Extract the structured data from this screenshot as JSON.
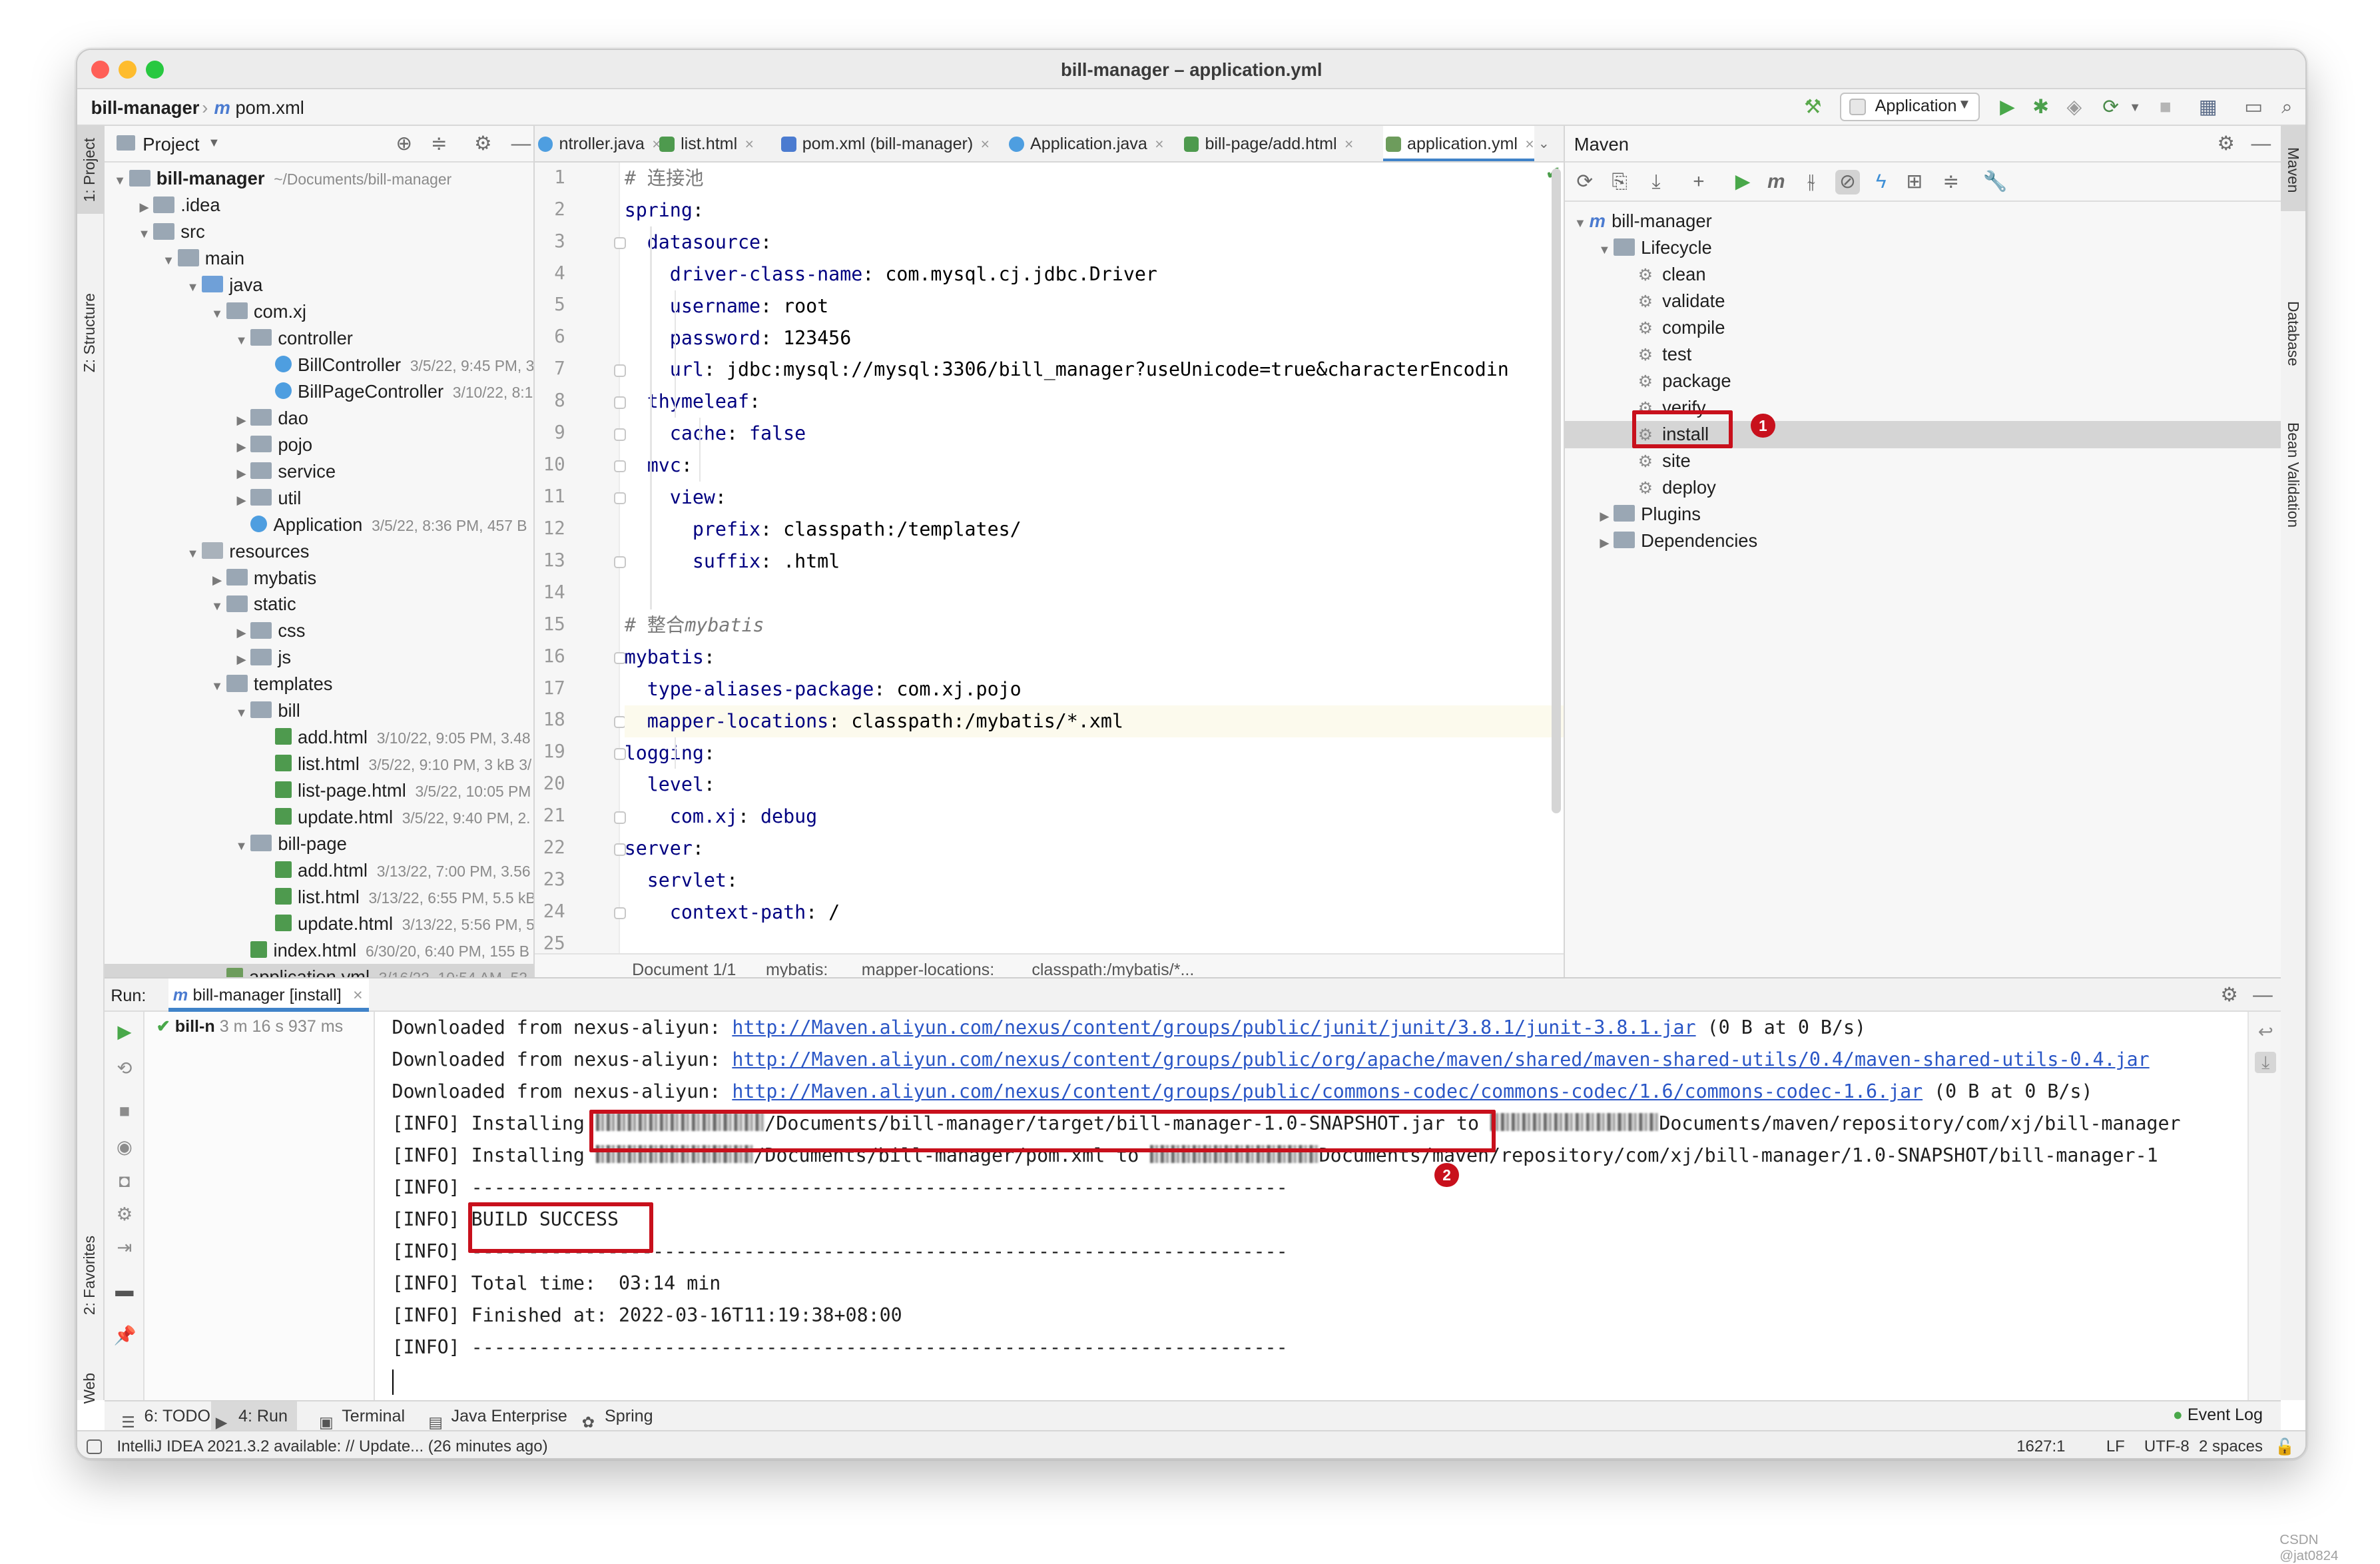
{
  "window": {
    "title": "bill-manager – application.yml"
  },
  "navbar": {
    "project": "bill-manager",
    "file": "pom.xml",
    "run_config": "Application"
  },
  "side_tabs": {
    "project": "1: Project",
    "structure": "Z: Structure",
    "favorites": "2: Favorites",
    "web": "Web",
    "maven": "Maven",
    "database": "Database",
    "bean_validation": "Bean Validation"
  },
  "project_panel": {
    "title": "Project",
    "tree": [
      {
        "level": 0,
        "arrow": "down",
        "icon": "folder",
        "label": "bill-manager",
        "bold": true,
        "meta": "~/Documents/bill-manager"
      },
      {
        "level": 1,
        "arrow": "right",
        "icon": "folder",
        "label": ".idea",
        "meta": ""
      },
      {
        "level": 1,
        "arrow": "down",
        "icon": "folder",
        "label": "src",
        "meta": ""
      },
      {
        "level": 2,
        "arrow": "down",
        "icon": "folder",
        "label": "main",
        "meta": ""
      },
      {
        "level": 3,
        "arrow": "down",
        "icon": "src",
        "label": "java",
        "meta": ""
      },
      {
        "level": 4,
        "arrow": "down",
        "icon": "folder",
        "label": "com.xj",
        "meta": ""
      },
      {
        "level": 5,
        "arrow": "down",
        "icon": "folder",
        "label": "controller",
        "meta": ""
      },
      {
        "level": 6,
        "arrow": "",
        "icon": "class",
        "label": "BillController",
        "meta": "3/5/22, 9:45 PM, 3"
      },
      {
        "level": 6,
        "arrow": "",
        "icon": "class",
        "label": "BillPageController",
        "meta": "3/10/22, 8:1"
      },
      {
        "level": 5,
        "arrow": "right",
        "icon": "folder",
        "label": "dao",
        "meta": ""
      },
      {
        "level": 5,
        "arrow": "right",
        "icon": "folder",
        "label": "pojo",
        "meta": ""
      },
      {
        "level": 5,
        "arrow": "right",
        "icon": "folder",
        "label": "service",
        "meta": ""
      },
      {
        "level": 5,
        "arrow": "right",
        "icon": "folder",
        "label": "util",
        "meta": ""
      },
      {
        "level": 5,
        "arrow": "",
        "icon": "class",
        "label": "Application",
        "meta": "3/5/22, 8:36 PM, 457 B"
      },
      {
        "level": 3,
        "arrow": "down",
        "icon": "res",
        "label": "resources",
        "meta": ""
      },
      {
        "level": 4,
        "arrow": "right",
        "icon": "folder",
        "label": "mybatis",
        "meta": ""
      },
      {
        "level": 4,
        "arrow": "down",
        "icon": "folder",
        "label": "static",
        "meta": ""
      },
      {
        "level": 5,
        "arrow": "right",
        "icon": "folder",
        "label": "css",
        "meta": ""
      },
      {
        "level": 5,
        "arrow": "right",
        "icon": "folder",
        "label": "js",
        "meta": ""
      },
      {
        "level": 4,
        "arrow": "down",
        "icon": "folder",
        "label": "templates",
        "meta": ""
      },
      {
        "level": 5,
        "arrow": "down",
        "icon": "folder",
        "label": "bill",
        "meta": ""
      },
      {
        "level": 6,
        "arrow": "",
        "icon": "html",
        "label": "add.html",
        "meta": "3/10/22, 9:05 PM, 3.48"
      },
      {
        "level": 6,
        "arrow": "",
        "icon": "html",
        "label": "list.html",
        "meta": "3/5/22, 9:10 PM, 3 kB 3/"
      },
      {
        "level": 6,
        "arrow": "",
        "icon": "html",
        "label": "list-page.html",
        "meta": "3/5/22, 10:05 PM"
      },
      {
        "level": 6,
        "arrow": "",
        "icon": "html",
        "label": "update.html",
        "meta": "3/5/22, 9:40 PM, 2."
      },
      {
        "level": 5,
        "arrow": "down",
        "icon": "folder",
        "label": "bill-page",
        "meta": ""
      },
      {
        "level": 6,
        "arrow": "",
        "icon": "html",
        "label": "add.html",
        "meta": "3/13/22, 7:00 PM, 3.56"
      },
      {
        "level": 6,
        "arrow": "",
        "icon": "html",
        "label": "list.html",
        "meta": "3/13/22, 6:55 PM, 5.5 kB"
      },
      {
        "level": 6,
        "arrow": "",
        "icon": "html",
        "label": "update.html",
        "meta": "3/13/22, 5:56 PM, 5"
      },
      {
        "level": 5,
        "arrow": "",
        "icon": "html",
        "label": "index.html",
        "meta": "6/30/20, 6:40 PM, 155 B"
      },
      {
        "level": 4,
        "arrow": "",
        "icon": "yml",
        "label": "application.yml",
        "meta": "3/16/22, 10:54 AM, 52"
      }
    ]
  },
  "editor": {
    "tabs": [
      {
        "label": "ntroller.java",
        "icon": "class",
        "active": false
      },
      {
        "label": "list.html",
        "icon": "html",
        "active": false
      },
      {
        "label": "pom.xml (bill-manager)",
        "icon": "maven",
        "active": false
      },
      {
        "label": "Application.java",
        "icon": "class",
        "active": false
      },
      {
        "label": "bill-page/add.html",
        "icon": "html",
        "active": false
      },
      {
        "label": "application.yml",
        "icon": "yml",
        "active": true
      }
    ],
    "lines": [
      {
        "n": "1",
        "segs": [
          [
            "cm",
            "# 连接池"
          ]
        ]
      },
      {
        "n": "2",
        "segs": [
          [
            "k",
            "spring"
          ],
          [
            "v",
            ":"
          ]
        ]
      },
      {
        "n": "3",
        "segs": [
          [
            "v",
            "  "
          ],
          [
            "k",
            "datasource"
          ],
          [
            "v",
            ":"
          ]
        ]
      },
      {
        "n": "4",
        "segs": [
          [
            "v",
            "    "
          ],
          [
            "k",
            "driver-class-name"
          ],
          [
            "v",
            ": com.mysql.cj.jdbc.Driver"
          ]
        ]
      },
      {
        "n": "5",
        "segs": [
          [
            "v",
            "    "
          ],
          [
            "k",
            "username"
          ],
          [
            "v",
            ": root"
          ]
        ]
      },
      {
        "n": "6",
        "segs": [
          [
            "v",
            "    "
          ],
          [
            "k",
            "password"
          ],
          [
            "v",
            ": 123456"
          ]
        ]
      },
      {
        "n": "7",
        "segs": [
          [
            "v",
            "    "
          ],
          [
            "k",
            "url"
          ],
          [
            "v",
            ": jdbc:mysql://mysql:3306/bill_manager?useUnicode=true&characterEncodin"
          ]
        ]
      },
      {
        "n": "8",
        "segs": [
          [
            "v",
            "  "
          ],
          [
            "k",
            "thymeleaf"
          ],
          [
            "v",
            ":"
          ]
        ]
      },
      {
        "n": "9",
        "segs": [
          [
            "v",
            "    "
          ],
          [
            "k",
            "cache"
          ],
          [
            "v",
            ": "
          ],
          [
            "b",
            "false"
          ]
        ]
      },
      {
        "n": "10",
        "segs": [
          [
            "v",
            "  "
          ],
          [
            "k",
            "mvc"
          ],
          [
            "v",
            ":"
          ]
        ]
      },
      {
        "n": "11",
        "segs": [
          [
            "v",
            "    "
          ],
          [
            "k",
            "view"
          ],
          [
            "v",
            ":"
          ]
        ]
      },
      {
        "n": "12",
        "segs": [
          [
            "v",
            "      "
          ],
          [
            "k",
            "prefix"
          ],
          [
            "v",
            ": classpath:/templates/"
          ]
        ]
      },
      {
        "n": "13",
        "segs": [
          [
            "v",
            "      "
          ],
          [
            "k",
            "suffix"
          ],
          [
            "v",
            ": .html"
          ]
        ]
      },
      {
        "n": "14",
        "segs": []
      },
      {
        "n": "15",
        "segs": [
          [
            "cm",
            "# 整合"
          ],
          [
            "cm-i",
            "mybatis"
          ]
        ]
      },
      {
        "n": "16",
        "segs": [
          [
            "k",
            "mybatis"
          ],
          [
            "v",
            ":"
          ]
        ]
      },
      {
        "n": "17",
        "segs": [
          [
            "v",
            "  "
          ],
          [
            "k",
            "type-aliases-package"
          ],
          [
            "v",
            ": com.xj.pojo"
          ]
        ]
      },
      {
        "n": "18",
        "segs": [
          [
            "v",
            "  "
          ],
          [
            "k",
            "mapper-locations"
          ],
          [
            "v",
            ": classpath:/mybatis/*.xml"
          ]
        ],
        "hl": true
      },
      {
        "n": "19",
        "segs": [
          [
            "k",
            "logging"
          ],
          [
            "v",
            ":"
          ]
        ]
      },
      {
        "n": "20",
        "segs": [
          [
            "v",
            "  "
          ],
          [
            "k",
            "level"
          ],
          [
            "v",
            ":"
          ]
        ]
      },
      {
        "n": "21",
        "segs": [
          [
            "v",
            "    "
          ],
          [
            "k",
            "com.xj"
          ],
          [
            "v",
            ": "
          ],
          [
            "b",
            "debug"
          ]
        ]
      },
      {
        "n": "22",
        "segs": [
          [
            "k",
            "server"
          ],
          [
            "v",
            ":"
          ]
        ]
      },
      {
        "n": "23",
        "segs": [
          [
            "v",
            "  "
          ],
          [
            "k",
            "servlet"
          ],
          [
            "v",
            ":"
          ]
        ]
      },
      {
        "n": "24",
        "segs": [
          [
            "v",
            "    "
          ],
          [
            "k",
            "context-path"
          ],
          [
            "v",
            ": /"
          ]
        ]
      },
      {
        "n": "25",
        "segs": []
      }
    ],
    "breadcrumb": [
      "Document 1/1",
      "mybatis:",
      "mapper-locations:",
      "classpath:/mybatis/*..."
    ]
  },
  "maven": {
    "title": "Maven",
    "tree": [
      {
        "level": 0,
        "arrow": "down",
        "icon": "maven",
        "label": "bill-manager"
      },
      {
        "level": 1,
        "arrow": "down",
        "icon": "folder",
        "label": "Lifecycle"
      },
      {
        "level": 2,
        "arrow": "",
        "icon": "gear",
        "label": "clean"
      },
      {
        "level": 2,
        "arrow": "",
        "icon": "gear",
        "label": "validate"
      },
      {
        "level": 2,
        "arrow": "",
        "icon": "gear",
        "label": "compile"
      },
      {
        "level": 2,
        "arrow": "",
        "icon": "gear",
        "label": "test"
      },
      {
        "level": 2,
        "arrow": "",
        "icon": "gear",
        "label": "package"
      },
      {
        "level": 2,
        "arrow": "",
        "icon": "gear",
        "label": "verify"
      },
      {
        "level": 2,
        "arrow": "",
        "icon": "gear",
        "label": "install",
        "selected": true
      },
      {
        "level": 2,
        "arrow": "",
        "icon": "gear",
        "label": "site"
      },
      {
        "level": 2,
        "arrow": "",
        "icon": "gear",
        "label": "deploy"
      },
      {
        "level": 1,
        "arrow": "right",
        "icon": "folder",
        "label": "Plugins"
      },
      {
        "level": 1,
        "arrow": "right",
        "icon": "folder",
        "label": "Dependencies"
      }
    ]
  },
  "run": {
    "label": "Run:",
    "tab": "bill-manager [install]",
    "tree_item": "bill-n",
    "tree_time": "3 m 16 s 937 ms",
    "console": [
      {
        "segs": [
          [
            "t",
            "Downloaded from nexus-aliyun: "
          ],
          [
            "link",
            "http://Maven.aliyun.com/nexus/content/groups/public/junit/junit/3.8.1/junit-3.8.1.jar"
          ],
          [
            "t",
            " (0 B at 0 B/s)"
          ]
        ]
      },
      {
        "segs": [
          [
            "t",
            "Downloaded from nexus-aliyun: "
          ],
          [
            "link",
            "http://Maven.aliyun.com/nexus/content/groups/public/org/apache/maven/shared/maven-shared-utils/0.4/maven-shared-utils-0.4.jar"
          ]
        ]
      },
      {
        "segs": [
          [
            "t",
            "Downloaded from nexus-aliyun: "
          ],
          [
            "link",
            "http://Maven.aliyun.com/nexus/content/groups/public/commons-codec/commons-codec/1.6/commons-codec-1.6.jar"
          ],
          [
            "t",
            " (0 B at 0 B/s)"
          ]
        ]
      },
      {
        "segs": [
          [
            "t",
            "[INFO] Installing "
          ],
          [
            "blur",
            "15"
          ],
          [
            "t",
            "/Documents/bill-manager/target/bill-manager-1.0-SNAPSHOT.jar to "
          ],
          [
            "blur",
            "15"
          ],
          [
            "t",
            "Documents/maven/repository/com/xj/bill-manager"
          ]
        ]
      },
      {
        "segs": [
          [
            "t",
            "[INFO] Installing "
          ],
          [
            "blur",
            "14"
          ],
          [
            "t",
            "/Documents/bill-manager/pom.xml to "
          ],
          [
            "blur",
            "15"
          ],
          [
            "t",
            "Documents/maven/repository/com/xj/bill-manager/1.0-SNAPSHOT/bill-manager-1"
          ]
        ]
      },
      {
        "segs": [
          [
            "t",
            "[INFO] ------------------------------------------------------------------------"
          ]
        ]
      },
      {
        "segs": [
          [
            "t",
            "[INFO] BUILD SUCCESS"
          ]
        ]
      },
      {
        "segs": [
          [
            "t",
            "[INFO] ------------------------------------------------------------------------"
          ]
        ]
      },
      {
        "segs": [
          [
            "t",
            "[INFO] Total time:  03:14 min"
          ]
        ]
      },
      {
        "segs": [
          [
            "t",
            "[INFO] Finished at: 2022-03-16T11:19:38+08:00"
          ]
        ]
      },
      {
        "segs": [
          [
            "t",
            "[INFO] ------------------------------------------------------------------------"
          ]
        ]
      }
    ]
  },
  "bottom_tabs": [
    {
      "label": "6: TODO",
      "icon": "☰"
    },
    {
      "label": "4: Run",
      "icon": "▶",
      "active": true
    },
    {
      "label": "Terminal",
      "icon": "▣"
    },
    {
      "label": "Java Enterprise",
      "icon": "▤"
    },
    {
      "label": "Spring",
      "icon": "✿"
    }
  ],
  "event_log": "Event Log",
  "status": {
    "message": "IntelliJ IDEA 2021.3.2 available: // Update... (26 minutes ago)",
    "position": "1627:1",
    "line_sep": "LF",
    "encoding": "UTF-8",
    "indent": "2 spaces"
  },
  "annotations": [
    "1",
    "2"
  ],
  "watermark": "CSDN @jat0824",
  "colors": {
    "accent": "#4083c9",
    "highlight_box": "#c8101c",
    "link": "#2a56c6",
    "yaml_key": "#000080"
  }
}
